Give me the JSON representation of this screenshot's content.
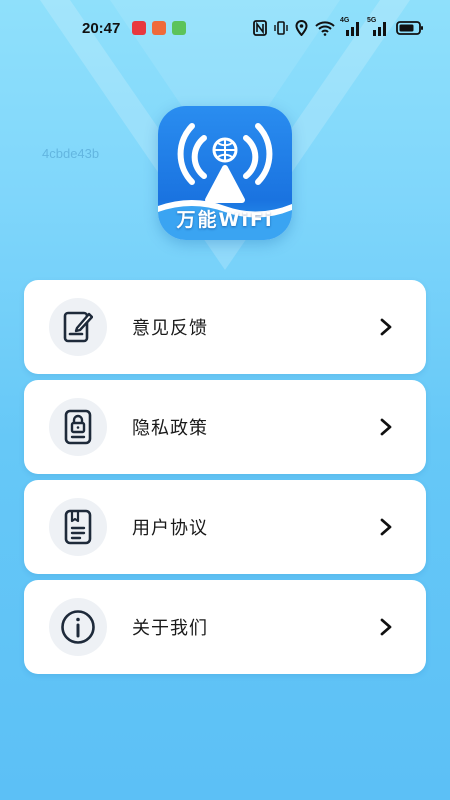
{
  "status_bar": {
    "time": "20:47",
    "notifications": [
      {
        "icon": "news-app-icon",
        "color": "#e8383d"
      },
      {
        "icon": "book-app-icon",
        "color": "#ef6a3a"
      },
      {
        "icon": "green-app-icon",
        "color": "#5cc35a"
      }
    ],
    "right_icons": [
      "nfc-icon",
      "vibrate-icon",
      "location-icon",
      "wifi-icon",
      "cellular-4g-icon",
      "cellular-5g-icon",
      "battery-icon"
    ],
    "network_labels": [
      "4G",
      "5G"
    ]
  },
  "watermark": "4cbde43b",
  "app_icon": {
    "label": "万能WiFi",
    "icon": "wifi-signal-tower-icon"
  },
  "menu": {
    "items": [
      {
        "label": "意见反馈",
        "icon": "feedback-edit-icon"
      },
      {
        "label": "隐私政策",
        "icon": "privacy-lock-icon"
      },
      {
        "label": "用户协议",
        "icon": "user-agreement-document-icon"
      },
      {
        "label": "关于我们",
        "icon": "info-icon"
      }
    ]
  },
  "colors": {
    "background_top": "#8fe0fb",
    "background_bottom": "#5cc0f6",
    "card": "#ffffff",
    "icon_stroke": "#1e2a3a",
    "app_icon_blue": "#1a73e0"
  }
}
